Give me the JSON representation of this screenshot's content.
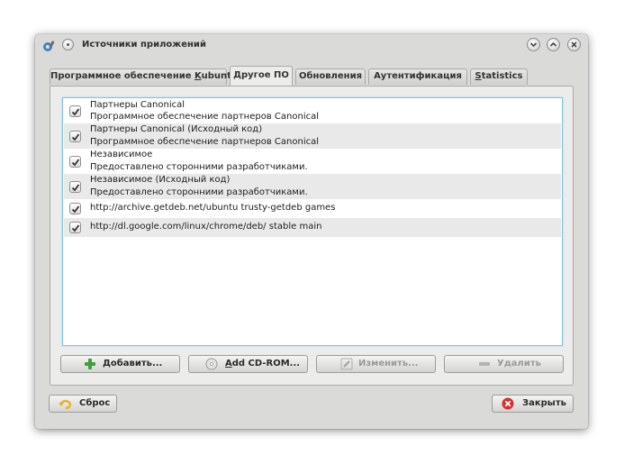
{
  "window": {
    "title": "Источники приложений"
  },
  "tabs": [
    {
      "pre": "Программное обеспечение ",
      "key": "K",
      "post": "ubuntu"
    },
    {
      "pre": "Другое ПО",
      "key": "",
      "post": ""
    },
    {
      "pre": "Обновления",
      "key": "",
      "post": ""
    },
    {
      "pre": "Аутентификация",
      "key": "",
      "post": ""
    },
    {
      "pre": "",
      "key": "S",
      "post": "tatistics"
    }
  ],
  "active_tab": "Другое ПО",
  "sources": [
    {
      "title": "Партнеры Canonical",
      "subtitle": "Программное обеспечение партнеров Canonical",
      "checked": true
    },
    {
      "title": "Партнеры Canonical (Исходный код)",
      "subtitle": "Программное обеспечение партнеров Canonical",
      "checked": true
    },
    {
      "title": "Независимое",
      "subtitle": "Предоставлено сторонними разработчиками.",
      "checked": true
    },
    {
      "title": "Независимое (Исходный код)",
      "subtitle": "Предоставлено сторонними разработчиками.",
      "checked": true
    },
    {
      "title": "http://archive.getdeb.net/ubuntu trusty-getdeb games",
      "subtitle": "",
      "checked": true
    },
    {
      "title": "http://dl.google.com/linux/chrome/deb/ stable main",
      "subtitle": "",
      "checked": true
    }
  ],
  "actions": {
    "add": "Добавить...",
    "add_cdrom_key": "A",
    "add_cdrom_rest": "dd CD-ROM...",
    "edit": "Изменить...",
    "remove": "Удалить"
  },
  "footer": {
    "reset": "Сброс",
    "close": "Закрыть"
  },
  "icons": {
    "app": "kubuntu-sources-icon",
    "add": "green-plus-icon",
    "cdrom": "cdrom-icon",
    "edit": "pencil-icon",
    "remove": "minus-icon",
    "reset": "undo-arrow-icon",
    "close": "red-x-circle-icon"
  },
  "colors": {
    "window_bg": "#dadad8",
    "list_focus": "#7cc3e8",
    "add_green": "#3aa33a",
    "close_red": "#d93030",
    "reset_yellow": "#e6b422"
  }
}
